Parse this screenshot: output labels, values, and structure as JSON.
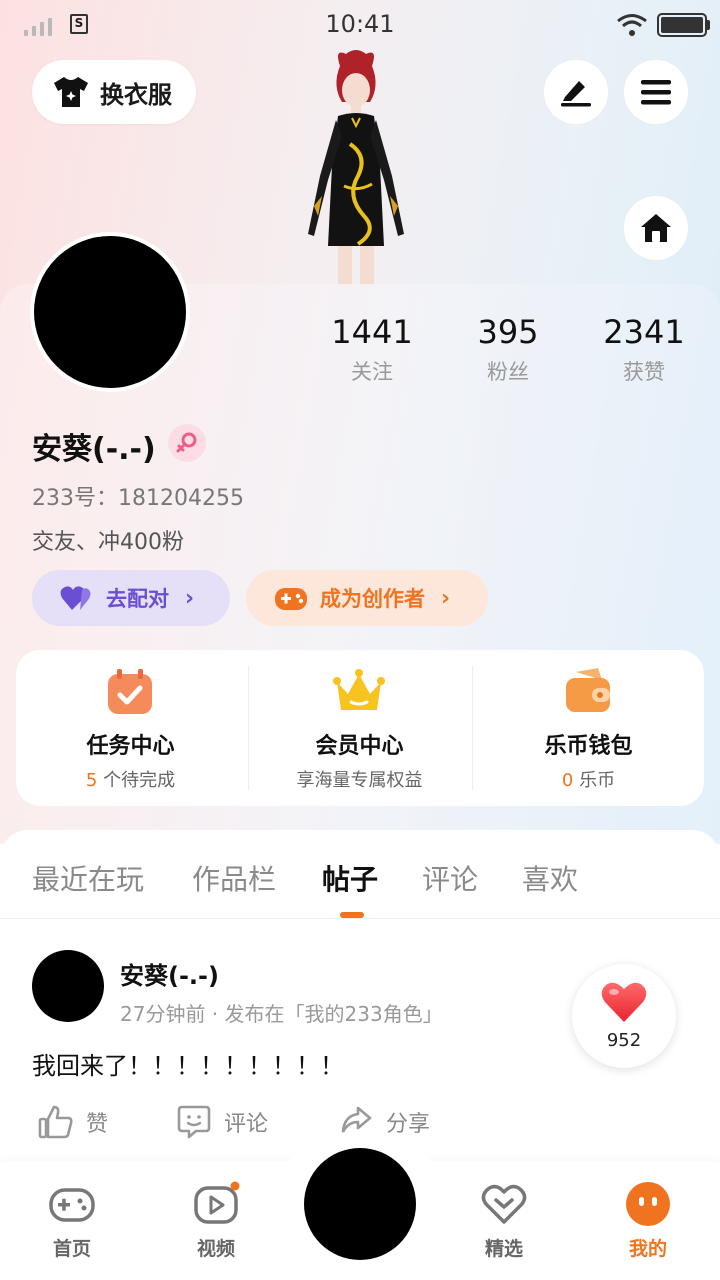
{
  "status_bar": {
    "time": "10:41",
    "sim_label": "S"
  },
  "header": {
    "change_clothes_label": "换衣服",
    "icons": [
      "tshirt-icon",
      "pen-icon",
      "menu-icon",
      "home-icon"
    ]
  },
  "profile": {
    "stats": [
      {
        "value": "1441",
        "label": "关注"
      },
      {
        "value": "395",
        "label": "粉丝"
      },
      {
        "value": "2341",
        "label": "获赞"
      }
    ],
    "username": "安葵(-.-)",
    "uid": "233号：181204255",
    "bio": "交友、冲400粉",
    "pair_button": "去配对",
    "creator_button": "成为创作者"
  },
  "services": [
    {
      "title": "任务中心",
      "highlight": "5",
      "sub": " 个待完成"
    },
    {
      "title": "会员中心",
      "highlight": "",
      "sub": "享海量专属权益"
    },
    {
      "title": "乐币钱包",
      "highlight": "0",
      "sub": " 乐币"
    }
  ],
  "tabs": [
    {
      "label": "最近在玩",
      "active": false
    },
    {
      "label": "作品栏",
      "active": false
    },
    {
      "label": "帖子",
      "active": true
    },
    {
      "label": "评论",
      "active": false
    },
    {
      "label": "喜欢",
      "active": false
    }
  ],
  "post": {
    "author": "安葵(-.-)",
    "meta": "27分钟前 · 发布在「我的233角色」",
    "body": "我回来了！！！！！！！！！",
    "like_count": "952",
    "actions": {
      "like": "赞",
      "comment": "评论",
      "share": "分享"
    }
  },
  "bottom_nav": [
    {
      "label": "首页"
    },
    {
      "label": "视频"
    },
    {
      "label": "精选"
    },
    {
      "label": "我的"
    }
  ],
  "colors": {
    "accent": "#f07420",
    "purple": "#6b4fd3",
    "pink_badge": "#fcdde6"
  }
}
